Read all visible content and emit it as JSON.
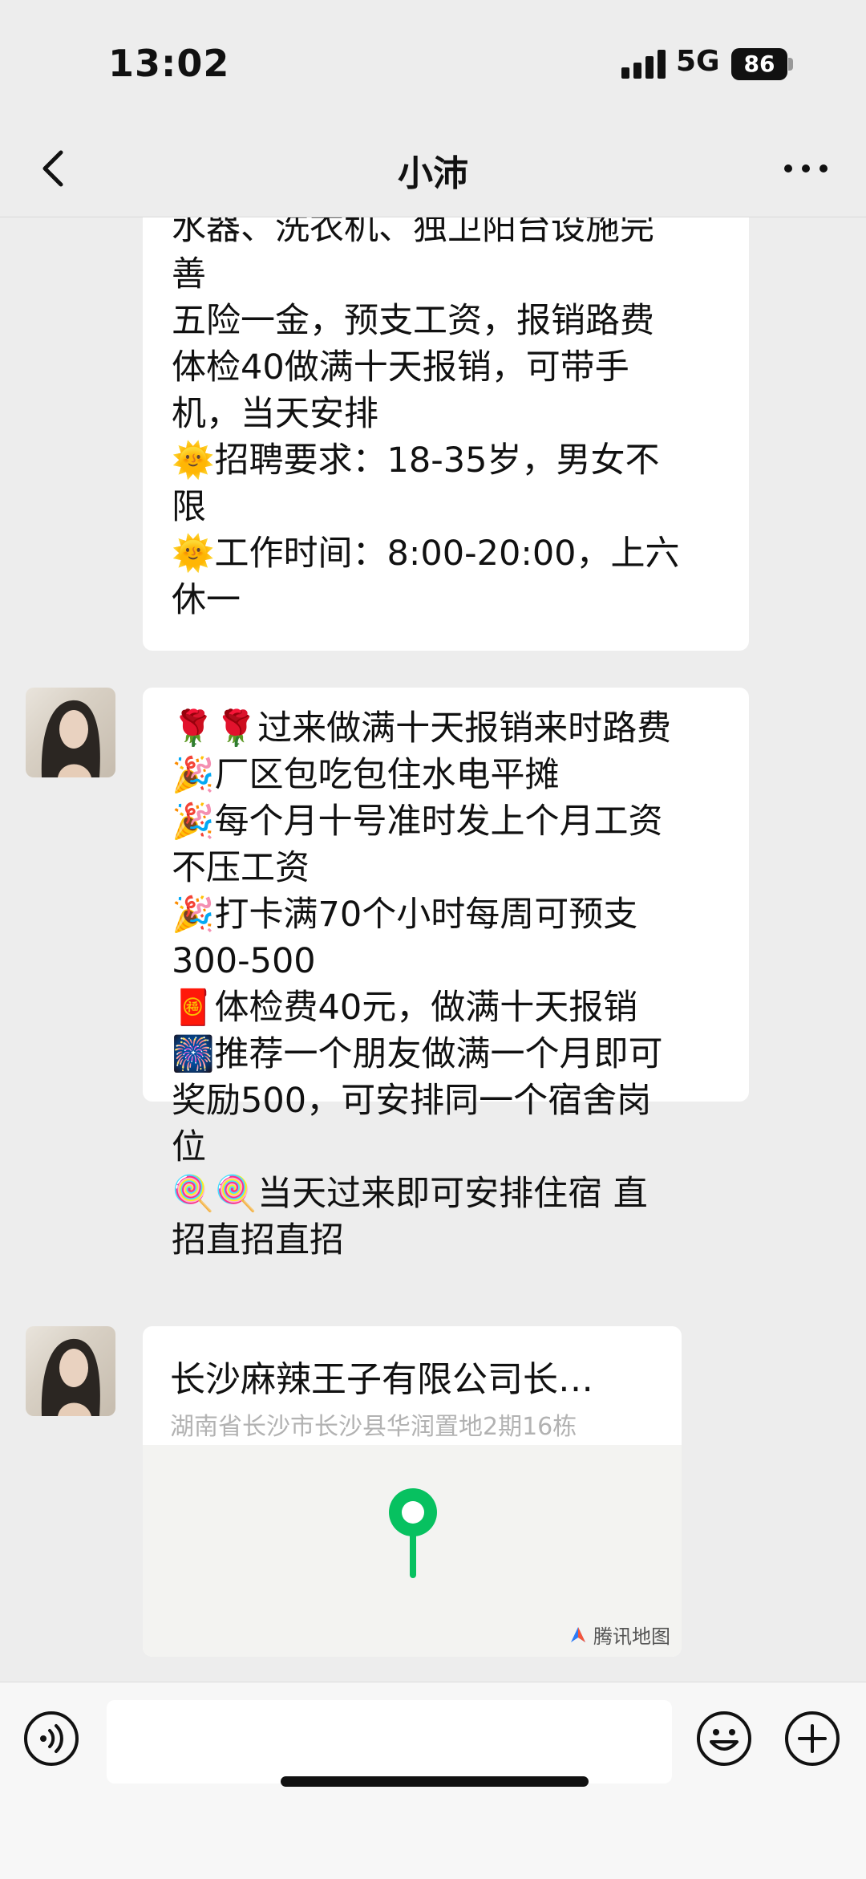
{
  "status_bar": {
    "time": "13:02",
    "network": "5G",
    "battery": "86"
  },
  "header": {
    "title": "小沛",
    "back_icon": "chevron-left-icon",
    "more_icon": "more-dots-icon"
  },
  "messages": [
    {
      "text": "水器、洗衣机、独卫阳台设施完\n善\n五险一金，预支工资，报销路费\n体检40做满十天报销，可带手\n机，当天安排\n🌞招聘要求：18-35岁，男女不\n限\n🌞工作时间：8:00-20:00，上六\n休一"
    },
    {
      "text": "🌹🌹过来做满十天报销来时路费\n🎉厂区包吃包住水电平摊\n🎉每个月十号准时发上个月工资\n不压工资\n🎉打卡满70个小时每周可预支\n300-500\n🧧体检费40元，做满十天报销\n🎆推荐一个朋友做满一个月即可\n奖励500，可安排同一个宿舍岗\n位\n🍭🍭当天过来即可安排住宿 直\n招直招直招"
    }
  ],
  "location": {
    "title": "长沙麻辣王子有限公司长…",
    "address": "湖南省长沙市长沙县华润置地2期16栋",
    "map_brand": "腾讯地图",
    "pin_color": "#07C160"
  },
  "input_bar": {
    "voice_icon": "voice-icon",
    "emoji_icon": "emoji-icon",
    "plus_icon": "plus-icon"
  }
}
